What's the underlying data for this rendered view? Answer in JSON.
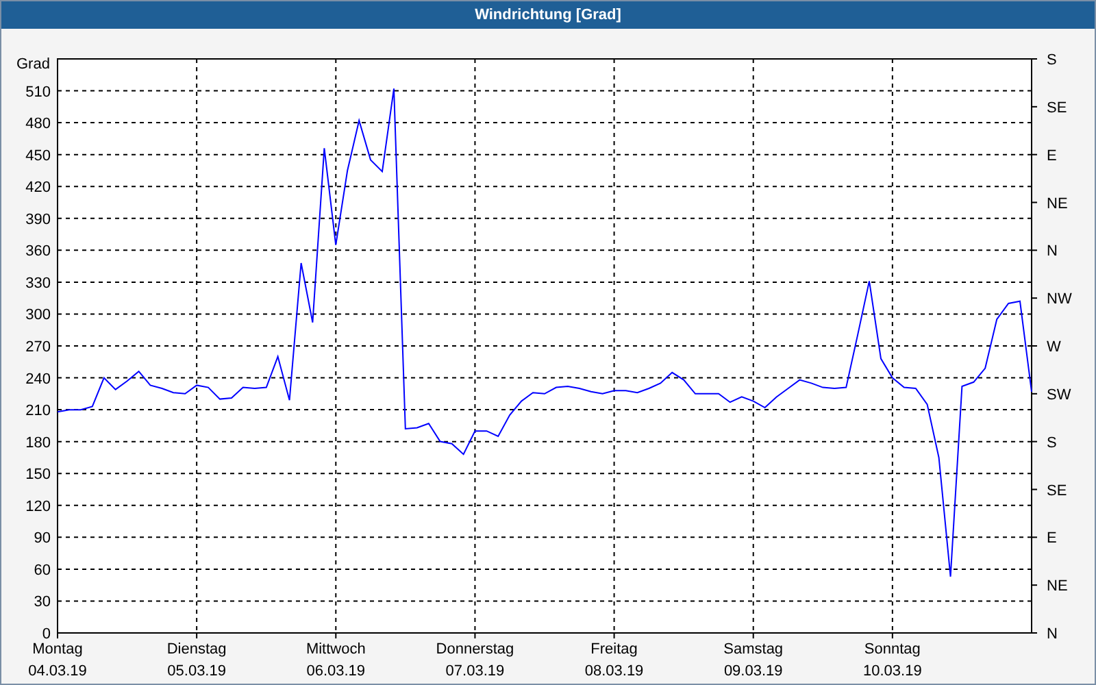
{
  "window": {
    "title": "Windrichtung [Grad]"
  },
  "chart_data": {
    "type": "line",
    "ylabel": "Grad",
    "ylim": [
      0,
      540
    ],
    "grid": true,
    "yticks": [
      0,
      30,
      60,
      90,
      120,
      150,
      180,
      210,
      240,
      270,
      300,
      330,
      360,
      390,
      420,
      450,
      480,
      510
    ],
    "categories": [
      "Montag\n04.03.19",
      null,
      null,
      null,
      null,
      null,
      null,
      null,
      null,
      null,
      null,
      null,
      "Dienstag\n05.03.19",
      null,
      null,
      null,
      null,
      null,
      null,
      null,
      null,
      null,
      null,
      null,
      "Mittwoch\n06.03.19",
      null,
      null,
      null,
      null,
      null,
      null,
      null,
      null,
      null,
      null,
      null,
      "Donnerstag\n07.03.19",
      null,
      null,
      null,
      null,
      null,
      null,
      null,
      null,
      null,
      null,
      null,
      "Freitag\n08.03.19",
      null,
      null,
      null,
      null,
      null,
      null,
      null,
      null,
      null,
      null,
      null,
      "Samstag\n09.03.19",
      null,
      null,
      null,
      null,
      null,
      null,
      null,
      null,
      null,
      null,
      null,
      "Sonntag\n10.03.19",
      null,
      null,
      null,
      null,
      null,
      null,
      null,
      null,
      null,
      null,
      null,
      null
    ],
    "series": [
      {
        "color": "#0000ff",
        "values": [
          208,
          210,
          210,
          213,
          240,
          229,
          237,
          246,
          233,
          230,
          226,
          225,
          233,
          231,
          220,
          221,
          231,
          230,
          231,
          260,
          219,
          348,
          292,
          456,
          365,
          435,
          482,
          445,
          434,
          512,
          192,
          193,
          197,
          180,
          178,
          168,
          190,
          190,
          185,
          205,
          218,
          226,
          225,
          231,
          232,
          230,
          227,
          225,
          228,
          228,
          226,
          230,
          235,
          245,
          238,
          225,
          225,
          225,
          217,
          222,
          218,
          212,
          222,
          230,
          238,
          235,
          231,
          230,
          231,
          280,
          331,
          258,
          240,
          231,
          230,
          215,
          165,
          53,
          232,
          236,
          249,
          295,
          310,
          312,
          227
        ]
      }
    ]
  },
  "direction_labels": [
    "S",
    "SE",
    "E",
    "NE",
    "N",
    "NW",
    "W",
    "SW",
    "S",
    "SE",
    "E",
    "NE",
    "N"
  ]
}
